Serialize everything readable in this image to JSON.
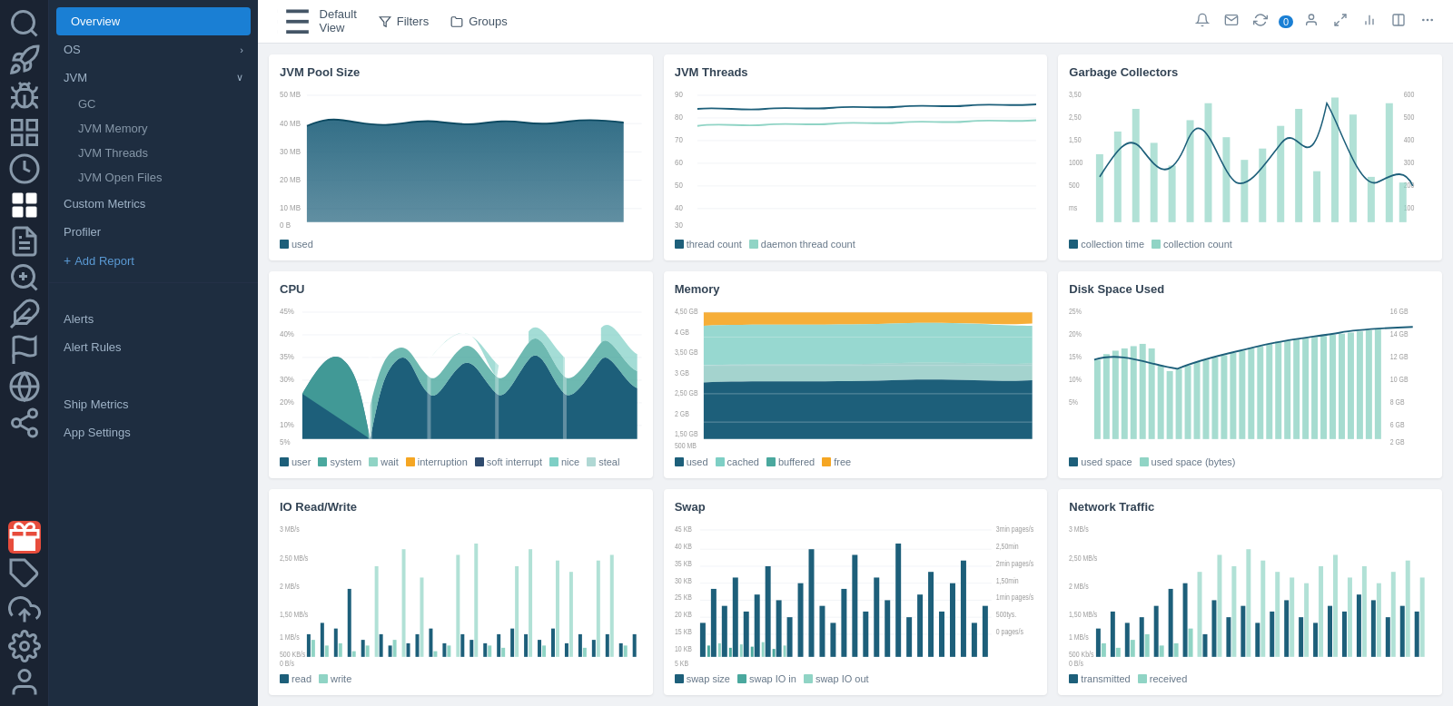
{
  "app": {
    "title": "Overview"
  },
  "topbar": {
    "default_view": "Default View",
    "filters": "Filters",
    "groups": "Groups",
    "badge_count": "0"
  },
  "nav": {
    "items": [
      {
        "id": "overview",
        "label": "Overview",
        "active": true
      },
      {
        "id": "os",
        "label": "OS",
        "has_arrow": true
      },
      {
        "id": "jvm",
        "label": "JVM",
        "has_arrow": true,
        "expanded": true
      },
      {
        "id": "gc",
        "label": "GC",
        "sub": true
      },
      {
        "id": "jvm-memory",
        "label": "JVM Memory",
        "sub": true
      },
      {
        "id": "jvm-threads",
        "label": "JVM Threads",
        "sub": true
      },
      {
        "id": "jvm-open-files",
        "label": "JVM Open Files",
        "sub": true
      },
      {
        "id": "custom-metrics",
        "label": "Custom Metrics"
      },
      {
        "id": "profiler",
        "label": "Profiler"
      },
      {
        "id": "add-report",
        "label": "Add Report",
        "special": "add"
      },
      {
        "id": "alerts",
        "label": "Alerts"
      },
      {
        "id": "alert-rules",
        "label": "Alert Rules"
      },
      {
        "id": "ship-metrics",
        "label": "Ship Metrics"
      },
      {
        "id": "app-settings",
        "label": "App Settings"
      }
    ]
  },
  "charts": [
    {
      "id": "jvm-pool-size",
      "title": "JVM Pool Size",
      "type": "area",
      "color": "#1d5f7a",
      "legend": [
        {
          "label": "used",
          "color": "#1d5f7a"
        }
      ]
    },
    {
      "id": "jvm-threads",
      "title": "JVM Threads",
      "type": "line",
      "legend": [
        {
          "label": "thread count",
          "color": "#1d5f7a"
        },
        {
          "label": "daemon thread count",
          "color": "#90d4c5"
        }
      ]
    },
    {
      "id": "garbage-collectors",
      "title": "Garbage Collectors",
      "type": "bar-line",
      "legend": [
        {
          "label": "collection time",
          "color": "#1d5f7a"
        },
        {
          "label": "collection count",
          "color": "#90d4c5"
        }
      ]
    },
    {
      "id": "cpu",
      "title": "CPU",
      "type": "stacked-area",
      "legend": [
        {
          "label": "user",
          "color": "#1d5f7a"
        },
        {
          "label": "system",
          "color": "#4aa89e"
        },
        {
          "label": "wait",
          "color": "#90d4c5"
        },
        {
          "label": "interruption",
          "color": "#f5a623"
        },
        {
          "label": "soft interrupt",
          "color": "#2e4a6d"
        },
        {
          "label": "nice",
          "color": "#7ecfc5"
        },
        {
          "label": "steal",
          "color": "#b0d8d4"
        }
      ]
    },
    {
      "id": "memory",
      "title": "Memory",
      "type": "stacked-area",
      "legend": [
        {
          "label": "used",
          "color": "#1d5f7a"
        },
        {
          "label": "cached",
          "color": "#7ecfc5"
        },
        {
          "label": "buffered",
          "color": "#90d4c5"
        },
        {
          "label": "free",
          "color": "#f5a623"
        }
      ]
    },
    {
      "id": "disk-space-used",
      "title": "Disk Space Used",
      "type": "bar-line",
      "legend": [
        {
          "label": "used space",
          "color": "#1d5f7a"
        },
        {
          "label": "used space (bytes)",
          "color": "#90d4c5"
        }
      ]
    },
    {
      "id": "io-read-write",
      "title": "IO Read/Write",
      "type": "bar",
      "legend": [
        {
          "label": "read",
          "color": "#1d5f7a"
        },
        {
          "label": "write",
          "color": "#90d4c5"
        }
      ]
    },
    {
      "id": "swap",
      "title": "Swap",
      "type": "bar",
      "legend": [
        {
          "label": "swap size",
          "color": "#1d5f7a"
        },
        {
          "label": "swap IO in",
          "color": "#4aa89e"
        },
        {
          "label": "swap IO out",
          "color": "#90d4c5"
        }
      ]
    },
    {
      "id": "network-traffic",
      "title": "Network Traffic",
      "type": "bar",
      "legend": [
        {
          "label": "transmitted",
          "color": "#1d5f7a"
        },
        {
          "label": "received",
          "color": "#90d4c5"
        }
      ]
    }
  ],
  "icons": {
    "search": "🔍",
    "rocket": "🚀",
    "bug": "🐛",
    "grid": "⊞",
    "clock": "🕐",
    "dashboard": "📊",
    "chart": "📈",
    "flag": "⚑",
    "globe": "🌐",
    "settings-icon": "⚙",
    "gift": "🎁",
    "tag": "🏷",
    "question": "?",
    "upload": "↑",
    "gear": "⚙",
    "user": "👤"
  }
}
